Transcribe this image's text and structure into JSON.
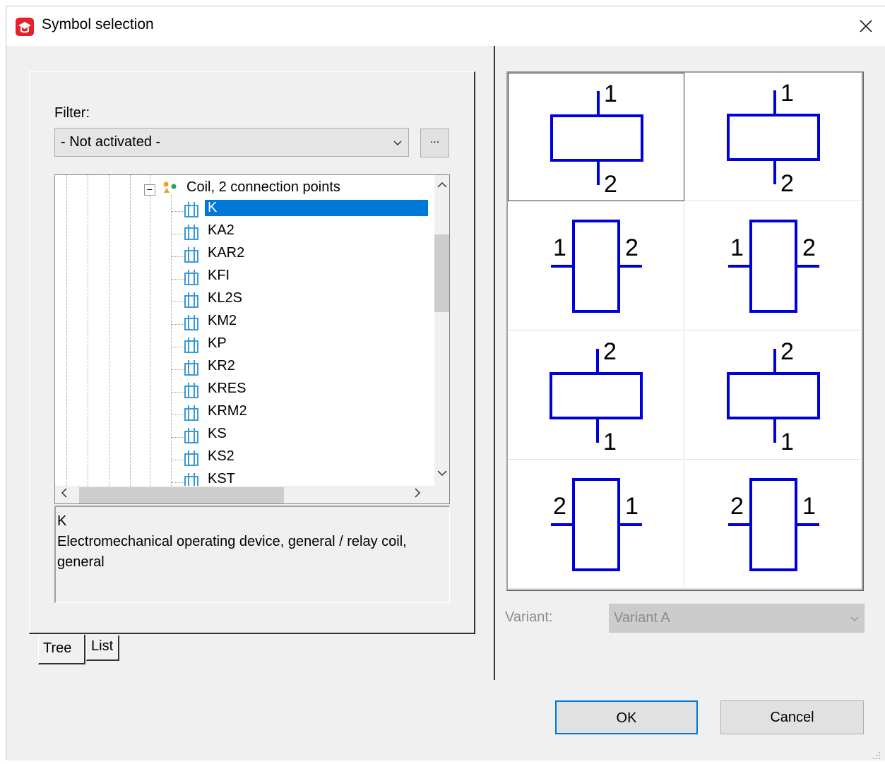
{
  "window": {
    "title": "Symbol selection"
  },
  "filter": {
    "label": "Filter:",
    "value": "- Not activated -",
    "more_button": "..."
  },
  "tree": {
    "parent": {
      "label": "Coil, 2 connection points",
      "expander": "−"
    },
    "items": [
      {
        "label": "K",
        "selected": true
      },
      {
        "label": "KA2"
      },
      {
        "label": "KAR2"
      },
      {
        "label": "KFI"
      },
      {
        "label": "KL2S"
      },
      {
        "label": "KM2"
      },
      {
        "label": "KP"
      },
      {
        "label": "KR2"
      },
      {
        "label": "KRES"
      },
      {
        "label": "KRM2"
      },
      {
        "label": "KS"
      },
      {
        "label": "KS2"
      },
      {
        "label": "KST"
      }
    ]
  },
  "description": {
    "name": "K",
    "text": "Electromechanical operating device, general / relay coil, general"
  },
  "tabs": {
    "tree": "Tree",
    "list": "List"
  },
  "symbols": [
    {
      "top": "1",
      "bottom": "2"
    },
    {
      "top": "1",
      "bottom": "2"
    },
    {
      "left": "1",
      "right": "2"
    },
    {
      "left": "1",
      "right": "2"
    },
    {
      "top": "2",
      "bottom": "1"
    },
    {
      "top": "2",
      "bottom": "1"
    },
    {
      "left": "2",
      "right": "1"
    },
    {
      "left": "2",
      "right": "1"
    }
  ],
  "symbol_color": "#0000dd",
  "selection_color": "#0078d7",
  "variant": {
    "label": "Variant:",
    "value": "Variant A"
  },
  "buttons": {
    "ok": "OK",
    "cancel": "Cancel"
  }
}
